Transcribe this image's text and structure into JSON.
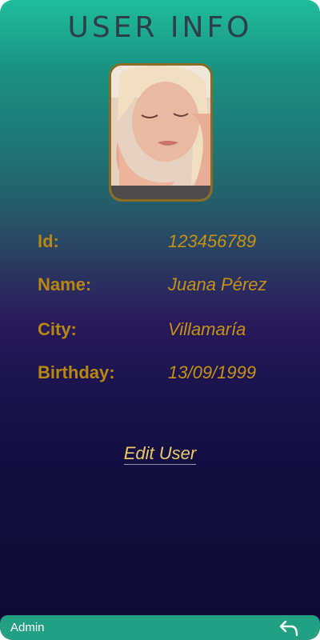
{
  "header": {
    "title": "USER INFO"
  },
  "fields": [
    {
      "label": "Id:",
      "value": "123456789"
    },
    {
      "label": "Name:",
      "value": "Juana Pérez"
    },
    {
      "label": "City:",
      "value": "Villamaría"
    },
    {
      "label": "Birthday:",
      "value": "13/09/1999"
    }
  ],
  "actions": {
    "edit_label": "Edit User"
  },
  "footer": {
    "user_label": "Admin",
    "back_icon": "back-arrow-icon"
  },
  "colors": {
    "accent": "#b8870f",
    "bar": "#21a083"
  }
}
